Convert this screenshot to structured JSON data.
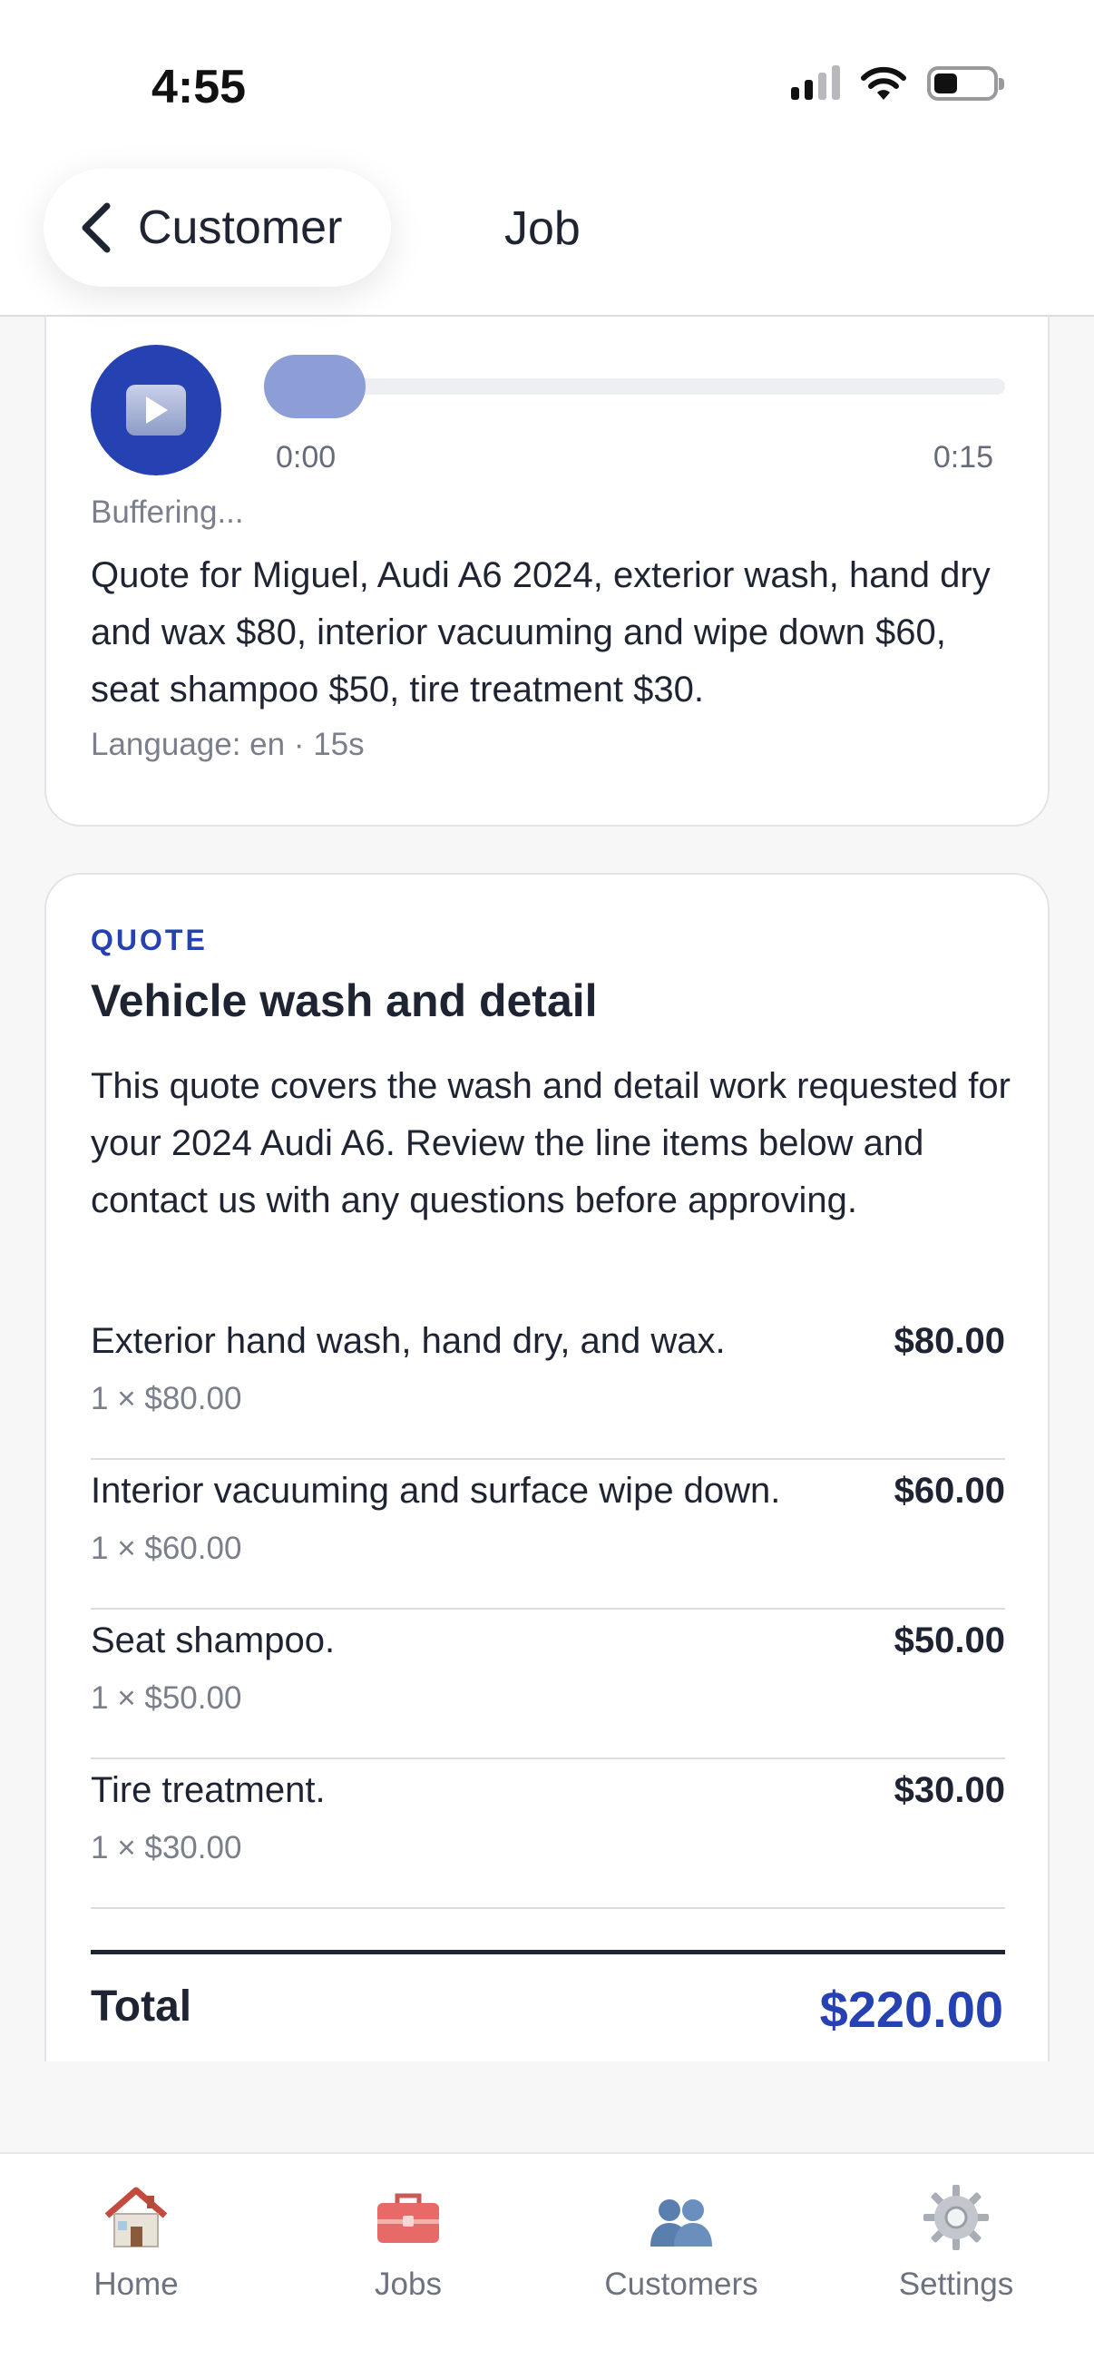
{
  "status_bar": {
    "time": "4:55"
  },
  "nav": {
    "back_label": "Customer",
    "title": "Job"
  },
  "audio": {
    "current_time": "0:00",
    "duration": "0:15",
    "progress_fraction": 0.0,
    "status": "Buffering...",
    "transcript": "Quote for Miguel, Audi A6 2024, exterior wash, hand dry and wax $80, interior vacuuming and wipe down $60, seat shampoo $50, tire treatment $30.",
    "meta": "Language: en · 15s"
  },
  "quote": {
    "kicker": "QUOTE",
    "title": "Vehicle wash and detail",
    "description": "This quote covers the wash and detail work requested for your 2024 Audi A6. Review the line items below and contact us with any questions before approving.",
    "line_items": [
      {
        "name": "Exterior hand wash, hand dry, and wax.",
        "qty_price": "1 × $80.00",
        "amount": "$80.00"
      },
      {
        "name": "Interior vacuuming and surface wipe down.",
        "qty_price": "1 × $60.00",
        "amount": "$60.00"
      },
      {
        "name": "Seat shampoo.",
        "qty_price": "1 × $50.00",
        "amount": "$50.00"
      },
      {
        "name": "Tire treatment.",
        "qty_price": "1 × $30.00",
        "amount": "$30.00"
      }
    ],
    "total_label": "Total",
    "total_value": "$220.00"
  },
  "tabs": [
    {
      "label": "Home",
      "icon": "house-icon",
      "active": false
    },
    {
      "label": "Jobs",
      "icon": "toolbox-icon",
      "active": false
    },
    {
      "label": "Customers",
      "icon": "people-icon",
      "active": true
    },
    {
      "label": "Settings",
      "icon": "gear-icon",
      "active": false
    }
  ],
  "colors": {
    "accent": "#2541b2",
    "text": "#1f2433",
    "muted": "#7a7f8b"
  }
}
